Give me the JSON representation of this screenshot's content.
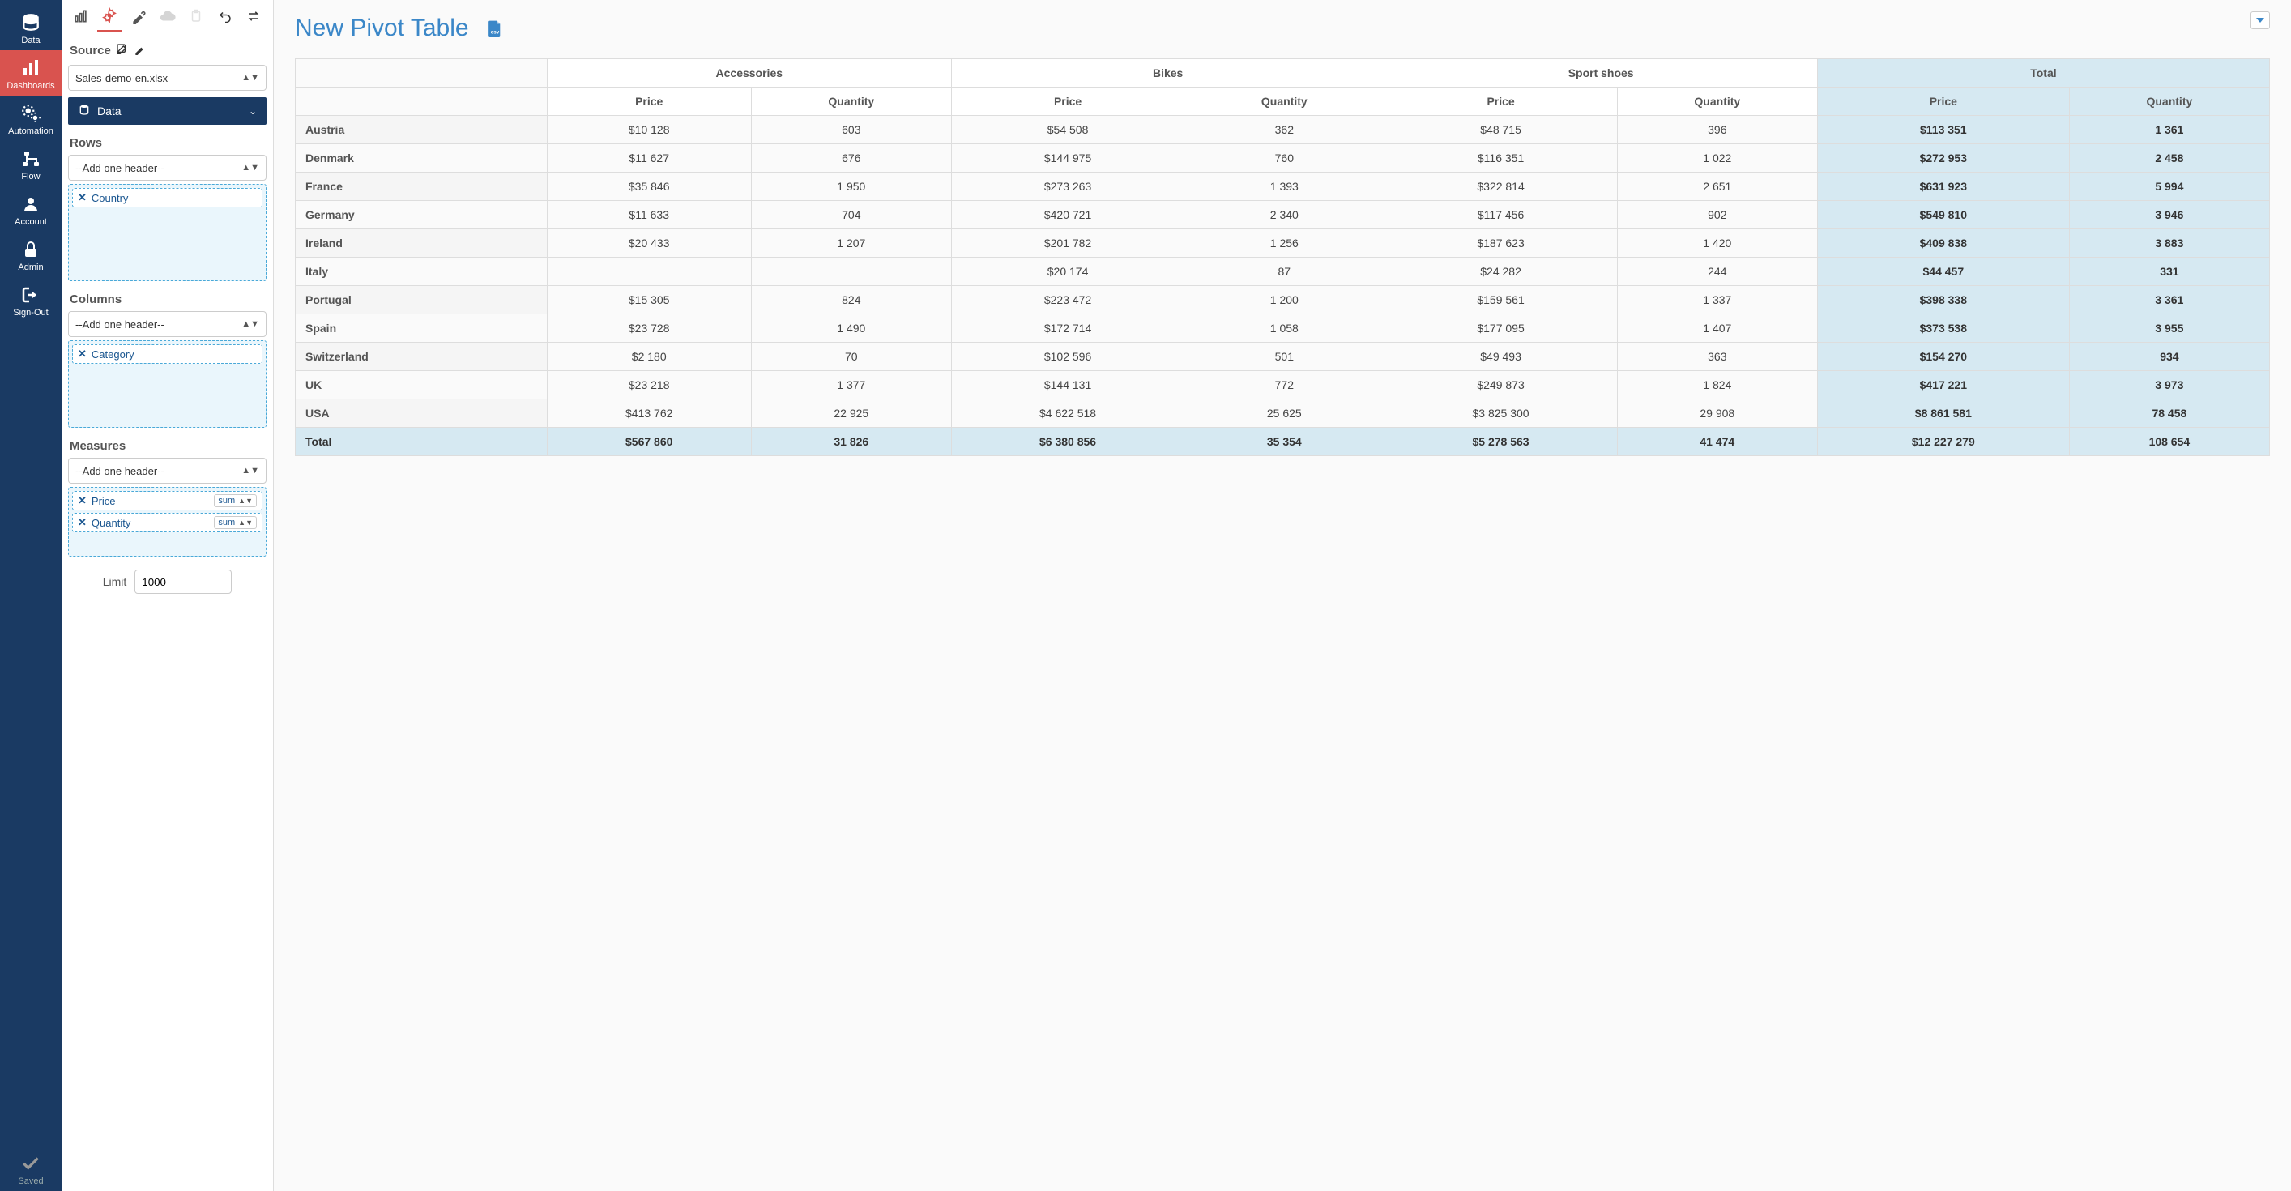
{
  "nav": [
    {
      "key": "data",
      "label": "Data"
    },
    {
      "key": "dashboards",
      "label": "Dashboards"
    },
    {
      "key": "automation",
      "label": "Automation"
    },
    {
      "key": "flow",
      "label": "Flow"
    },
    {
      "key": "account",
      "label": "Account"
    },
    {
      "key": "admin",
      "label": "Admin"
    },
    {
      "key": "signout",
      "label": "Sign-Out"
    }
  ],
  "nav_saved": "Saved",
  "panel": {
    "source_label": "Source",
    "source_value": "Sales-demo-en.xlsx",
    "data_accordion": "Data",
    "rows_label": "Rows",
    "rows_placeholder": "--Add one header--",
    "rows_pills": [
      "Country"
    ],
    "cols_label": "Columns",
    "cols_placeholder": "--Add one header--",
    "cols_pills": [
      "Category"
    ],
    "measures_label": "Measures",
    "measures_placeholder": "--Add one header--",
    "measures_pills": [
      {
        "name": "Price",
        "agg": "sum"
      },
      {
        "name": "Quantity",
        "agg": "sum"
      }
    ],
    "limit_label": "Limit",
    "limit_value": "1000"
  },
  "main": {
    "title": "New Pivot Table"
  },
  "pivot": {
    "col_groups": [
      "Accessories",
      "Bikes",
      "Sport shoes",
      "Total"
    ],
    "sub_cols": [
      "Price",
      "Quantity"
    ],
    "rows": [
      {
        "h": "Austria",
        "v": [
          "$10 128",
          "603",
          "$54 508",
          "362",
          "$48 715",
          "396",
          "$113 351",
          "1 361"
        ]
      },
      {
        "h": "Denmark",
        "v": [
          "$11 627",
          "676",
          "$144 975",
          "760",
          "$116 351",
          "1 022",
          "$272 953",
          "2 458"
        ]
      },
      {
        "h": "France",
        "v": [
          "$35 846",
          "1 950",
          "$273 263",
          "1 393",
          "$322 814",
          "2 651",
          "$631 923",
          "5 994"
        ]
      },
      {
        "h": "Germany",
        "v": [
          "$11 633",
          "704",
          "$420 721",
          "2 340",
          "$117 456",
          "902",
          "$549 810",
          "3 946"
        ]
      },
      {
        "h": "Ireland",
        "v": [
          "$20 433",
          "1 207",
          "$201 782",
          "1 256",
          "$187 623",
          "1 420",
          "$409 838",
          "3 883"
        ]
      },
      {
        "h": "Italy",
        "v": [
          "",
          "",
          "$20 174",
          "87",
          "$24 282",
          "244",
          "$44 457",
          "331"
        ]
      },
      {
        "h": "Portugal",
        "v": [
          "$15 305",
          "824",
          "$223 472",
          "1 200",
          "$159 561",
          "1 337",
          "$398 338",
          "3 361"
        ]
      },
      {
        "h": "Spain",
        "v": [
          "$23 728",
          "1 490",
          "$172 714",
          "1 058",
          "$177 095",
          "1 407",
          "$373 538",
          "3 955"
        ]
      },
      {
        "h": "Switzerland",
        "v": [
          "$2 180",
          "70",
          "$102 596",
          "501",
          "$49 493",
          "363",
          "$154 270",
          "934"
        ]
      },
      {
        "h": "UK",
        "v": [
          "$23 218",
          "1 377",
          "$144 131",
          "772",
          "$249 873",
          "1 824",
          "$417 221",
          "3 973"
        ]
      },
      {
        "h": "USA",
        "v": [
          "$413 762",
          "22 925",
          "$4 622 518",
          "25 625",
          "$3 825 300",
          "29 908",
          "$8 861 581",
          "78 458"
        ]
      }
    ],
    "total_row": {
      "h": "Total",
      "v": [
        "$567 860",
        "31 826",
        "$6 380 856",
        "35 354",
        "$5 278 563",
        "41 474",
        "$12 227 279",
        "108 654"
      ]
    }
  },
  "chart_data": {
    "type": "table",
    "title": "New Pivot Table",
    "row_dimension": "Country",
    "col_dimension": "Category",
    "measures": [
      "Price",
      "Quantity"
    ],
    "categories": [
      "Accessories",
      "Bikes",
      "Sport shoes"
    ],
    "rows": [
      "Austria",
      "Denmark",
      "France",
      "Germany",
      "Ireland",
      "Italy",
      "Portugal",
      "Spain",
      "Switzerland",
      "UK",
      "USA"
    ],
    "data": {
      "Austria": {
        "Accessories": {
          "Price": 10128,
          "Quantity": 603
        },
        "Bikes": {
          "Price": 54508,
          "Quantity": 362
        },
        "Sport shoes": {
          "Price": 48715,
          "Quantity": 396
        }
      },
      "Denmark": {
        "Accessories": {
          "Price": 11627,
          "Quantity": 676
        },
        "Bikes": {
          "Price": 144975,
          "Quantity": 760
        },
        "Sport shoes": {
          "Price": 116351,
          "Quantity": 1022
        }
      },
      "France": {
        "Accessories": {
          "Price": 35846,
          "Quantity": 1950
        },
        "Bikes": {
          "Price": 273263,
          "Quantity": 1393
        },
        "Sport shoes": {
          "Price": 322814,
          "Quantity": 2651
        }
      },
      "Germany": {
        "Accessories": {
          "Price": 11633,
          "Quantity": 704
        },
        "Bikes": {
          "Price": 420721,
          "Quantity": 2340
        },
        "Sport shoes": {
          "Price": 117456,
          "Quantity": 902
        }
      },
      "Ireland": {
        "Accessories": {
          "Price": 20433,
          "Quantity": 1207
        },
        "Bikes": {
          "Price": 201782,
          "Quantity": 1256
        },
        "Sport shoes": {
          "Price": 187623,
          "Quantity": 1420
        }
      },
      "Italy": {
        "Accessories": {
          "Price": null,
          "Quantity": null
        },
        "Bikes": {
          "Price": 20174,
          "Quantity": 87
        },
        "Sport shoes": {
          "Price": 24282,
          "Quantity": 244
        }
      },
      "Portugal": {
        "Accessories": {
          "Price": 15305,
          "Quantity": 824
        },
        "Bikes": {
          "Price": 223472,
          "Quantity": 1200
        },
        "Sport shoes": {
          "Price": 159561,
          "Quantity": 1337
        }
      },
      "Spain": {
        "Accessories": {
          "Price": 23728,
          "Quantity": 1490
        },
        "Bikes": {
          "Price": 172714,
          "Quantity": 1058
        },
        "Sport shoes": {
          "Price": 177095,
          "Quantity": 1407
        }
      },
      "Switzerland": {
        "Accessories": {
          "Price": 2180,
          "Quantity": 70
        },
        "Bikes": {
          "Price": 102596,
          "Quantity": 501
        },
        "Sport shoes": {
          "Price": 49493,
          "Quantity": 363
        }
      },
      "UK": {
        "Accessories": {
          "Price": 23218,
          "Quantity": 1377
        },
        "Bikes": {
          "Price": 144131,
          "Quantity": 772
        },
        "Sport shoes": {
          "Price": 249873,
          "Quantity": 1824
        }
      },
      "USA": {
        "Accessories": {
          "Price": 413762,
          "Quantity": 22925
        },
        "Bikes": {
          "Price": 4622518,
          "Quantity": 25625
        },
        "Sport shoes": {
          "Price": 3825300,
          "Quantity": 29908
        }
      }
    },
    "row_totals": {
      "Austria": {
        "Price": 113351,
        "Quantity": 1361
      },
      "Denmark": {
        "Price": 272953,
        "Quantity": 2458
      },
      "France": {
        "Price": 631923,
        "Quantity": 5994
      },
      "Germany": {
        "Price": 549810,
        "Quantity": 3946
      },
      "Ireland": {
        "Price": 409838,
        "Quantity": 3883
      },
      "Italy": {
        "Price": 44457,
        "Quantity": 331
      },
      "Portugal": {
        "Price": 398338,
        "Quantity": 3361
      },
      "Spain": {
        "Price": 373538,
        "Quantity": 3955
      },
      "Switzerland": {
        "Price": 154270,
        "Quantity": 934
      },
      "UK": {
        "Price": 417221,
        "Quantity": 3973
      },
      "USA": {
        "Price": 8861581,
        "Quantity": 78458
      }
    },
    "col_totals": {
      "Accessories": {
        "Price": 567860,
        "Quantity": 31826
      },
      "Bikes": {
        "Price": 6380856,
        "Quantity": 35354
      },
      "Sport shoes": {
        "Price": 5278563,
        "Quantity": 41474
      }
    },
    "grand_total": {
      "Price": 12227279,
      "Quantity": 108654
    }
  }
}
